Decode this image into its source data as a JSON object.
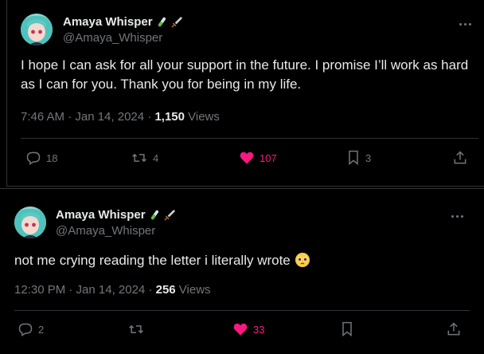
{
  "tweets": [
    {
      "author": {
        "name": "Amaya Whisper",
        "handle": "@Amaya_Whisper",
        "badges": [
          "test-tube-icon",
          "dagger-icon"
        ]
      },
      "text": "I hope I can ask for all your support in the future. I promise I’ll work as hard as I can for you. Thank you for being in my life.",
      "time": "7:46 AM · Jan 14, 2024 · ",
      "views_count": "1,150",
      "views_label": " Views",
      "actions": {
        "replies": "18",
        "reposts": "4",
        "likes": "107",
        "bookmarks": "3"
      }
    },
    {
      "author": {
        "name": "Amaya Whisper",
        "handle": "@Amaya_Whisper",
        "badges": [
          "test-tube-icon",
          "dagger-icon"
        ]
      },
      "text": "not me crying reading the letter i literally wrote ",
      "emoji": "pleading-face-icon",
      "time": "12:30 PM · Jan 14, 2024 · ",
      "views_count": "256",
      "views_label": " Views",
      "actions": {
        "replies": "2",
        "reposts": "",
        "likes": "33",
        "bookmarks": ""
      }
    }
  ],
  "colors": {
    "background": "#000000",
    "text": "#e7e9ea",
    "secondary": "#71767b",
    "like": "#f91880",
    "border": "#2f3336"
  }
}
